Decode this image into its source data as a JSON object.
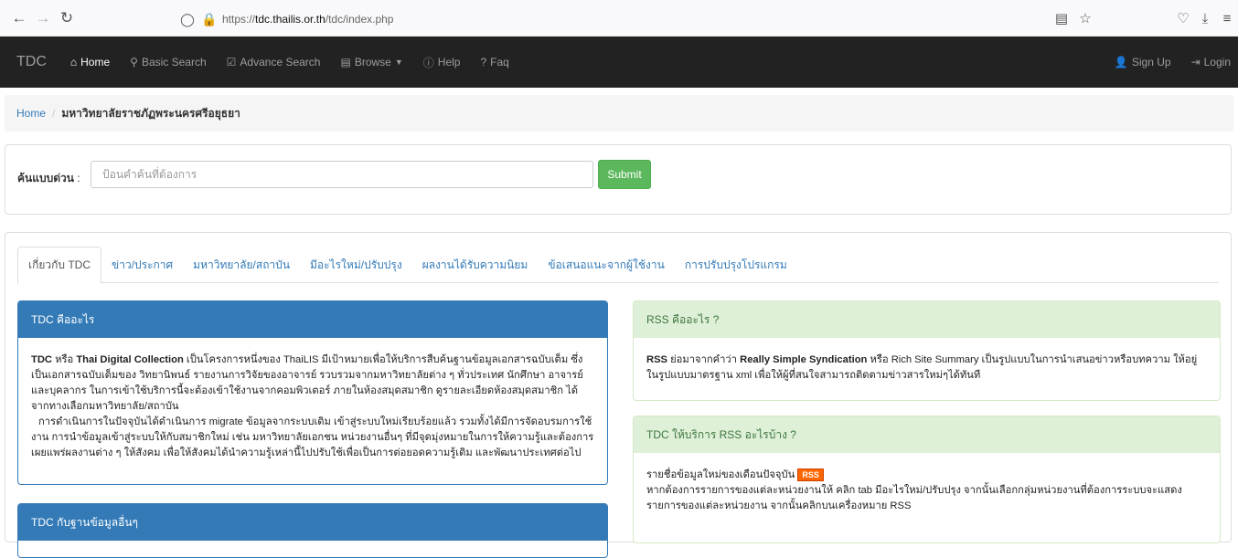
{
  "browser": {
    "url_host": "tdc.thailis.or.th",
    "url_prefix": "https://",
    "url_path": "/tdc/index.php"
  },
  "navbar": {
    "brand": "TDC",
    "items": [
      {
        "label": "Home",
        "icon": "home-icon"
      },
      {
        "label": "Basic Search",
        "icon": "search-icon"
      },
      {
        "label": "Advance Search",
        "icon": "edit-icon"
      },
      {
        "label": "Browse",
        "icon": "list-icon"
      },
      {
        "label": "Help",
        "icon": "info-icon"
      },
      {
        "label": "Faq",
        "icon": "question-icon"
      }
    ],
    "sign_up": "Sign Up",
    "login": "Login"
  },
  "breadcrumb": {
    "home": "Home",
    "current": "มหาวิทยาลัยราชภัฏพระนครศรีอยุธยา"
  },
  "search": {
    "label": "ค้นแบบด่วน",
    "colon": " :",
    "placeholder": "ป้อนคำค้นที่ต้องการ",
    "submit": "Submit"
  },
  "tabs": [
    "เกี่ยวกับ TDC",
    "ข่าว/ประกาศ",
    "มหาวิทยาลัย/สถาบัน",
    "มีอะไรใหม่/ปรับปรุง",
    "ผลงานได้รับความนิยม",
    "ข้อเสนอแนะจากผู้ใช้งาน",
    "การปรับปรุงโปรแกรม"
  ],
  "panels": {
    "what_is_tdc": {
      "title": "TDC คืออะไร",
      "lead_bold": "TDC",
      "lead_mid": " หรือ ",
      "name_bold": "Thai Digital Collection",
      "p1_rest": " เป็นโครงการหนึ่งของ ThaiLIS มีเป้าหมายเพื่อให้บริการสืบค้นฐานข้อมูลเอกสารฉบับเต็ม ซึ่งเป็นเอกสารฉบับเต็มของ วิทยานิพนธ์ รายงานการวิจัยของอาจารย์ รวบรวมจากมหาวิทยาลัยต่าง ๆ ทั่วประเทศ นักศึกษา อาจารย์ และบุคลากร ในการเข้าใช้บริการนี้จะต้องเข้าใช้งานจากคอมพิวเตอร์ ภายในห้องสมุดสมาชิก ดูรายละเอียดห้องสมุดสมาชิก ได้จากทางเลือกมหาวิทยาลัย/สถาบัน",
      "p2": "การดำเนินการในปัจจุบันได้ดำเนินการ migrate ข้อมูลจากระบบเดิม เข้าสู่ระบบใหม่เรียบร้อยแล้ว รวมทั้งได้มีการจัดอบรมการใช้งาน การนำข้อมูลเข้าสู่ระบบให้กับสมาชิกใหม่ เช่น มหาวิทยาลัยเอกชน หน่วยงานอื่นๆ ที่มีจุดมุ่งหมายในการให้ความรู้และต้องการเผยแพร่ผลงานต่าง ๆ ให้สังคม เพื่อให้สังคมได้นำความรู้เหล่านี้ไปปรับใช้เพื่อเป็นการต่อยอดความรู้เดิม และพัฒนาประเทศต่อไป"
    },
    "tdc_other": {
      "title": "TDC กับฐานข้อมูลอื่นๆ"
    },
    "what_is_rss": {
      "title": "RSS คืออะไร ?",
      "lead_bold": "RSS",
      "mid": " ย่อมาจากคำว่า ",
      "name_bold": "Really Simple Syndication",
      "rest": " หรือ Rich Site Summary เป็นรูปแบบในการนำเสนอข่าวหรือบทความ ให้อยู่ในรูปแบบมาตรฐาน xml เพื่อให้ผู้ที่สนใจสามารถติดตามข่าวสารใหม่ๆได้ทันที"
    },
    "tdc_rss": {
      "title": "TDC ให้บริการ RSS อะไรบ้าง ?",
      "line1": "รายชื่อข้อมูลใหม่ของเดือนปัจจุบัน",
      "badge": "RSS",
      "line2": "หากต้องการรายการของแต่ละหน่วยงานให้ คลิก tab มีอะไรใหม่/ปรับปรุง จากนั้นเลือกกลุ่มหน่วยงานที่ต้องการระบบจะแสดงรายการของแต่ละหน่วยงาน จากนั้นคลิกบนเครื่องหมาย RSS"
    }
  },
  "colors": {
    "navbar_bg": "#222222",
    "primary": "#337ab7",
    "success_bg": "#dff0d8",
    "submit": "#5cb85c",
    "rss_badge": "#ff6600"
  }
}
